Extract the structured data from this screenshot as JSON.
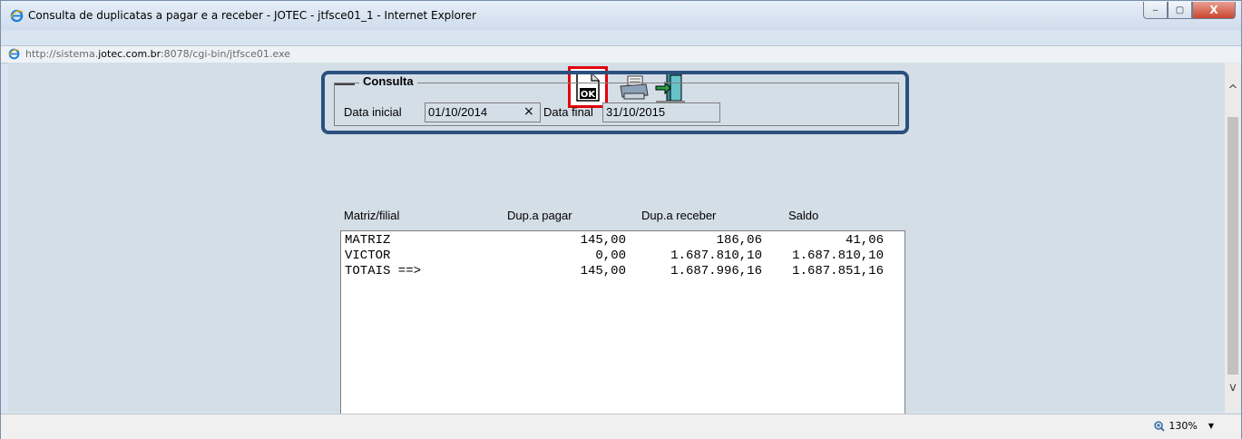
{
  "window": {
    "title": "Consulta de duplicatas a pagar e a receber - JOTEC - jtfsce01_1 - Internet Explorer",
    "minimize_label": "‒",
    "maximize_label": "▢",
    "close_label": "X"
  },
  "address": {
    "prefix": "http://sistema.",
    "domain": "jotec.com.br",
    "suffix": ":8078/cgi-bin/jtfsce01.exe"
  },
  "toolbar": {
    "ok_icon": "ok-document-icon",
    "print_icon": "printer-icon",
    "exit_icon": "exit-door-icon",
    "ok_label": "OK",
    "highlight_color": "#e0000b"
  },
  "consulta": {
    "legend": "Consulta",
    "data_inicial_label": "Data inicial",
    "data_inicial_value": "01/10/2014",
    "clear_label": "×",
    "data_final_label": "Data final",
    "data_final_value": "31/10/2015",
    "outline_color": "#2b4f7e"
  },
  "table": {
    "headers": {
      "matriz": "Matriz/filial",
      "pagar": "Dup.a pagar",
      "receber": "Dup.a receber",
      "saldo": "Saldo"
    },
    "rows": [
      {
        "name": "MATRIZ",
        "pagar": "145,00",
        "receber": "186,06",
        "saldo": "41,06"
      },
      {
        "name": "VICTOR",
        "pagar": "0,00",
        "receber": "1.687.810,10",
        "saldo": "1.687.810,10"
      },
      {
        "name": "TOTAIS ==>",
        "pagar": "145,00",
        "receber": "1.687.996,16",
        "saldo": "1.687.851,16"
      }
    ]
  },
  "statusbar": {
    "zoom": "130%",
    "zoom_icon": "zoom-icon",
    "zoom_arrow": "▼"
  },
  "scroll": {
    "up": "^",
    "down": "v"
  }
}
